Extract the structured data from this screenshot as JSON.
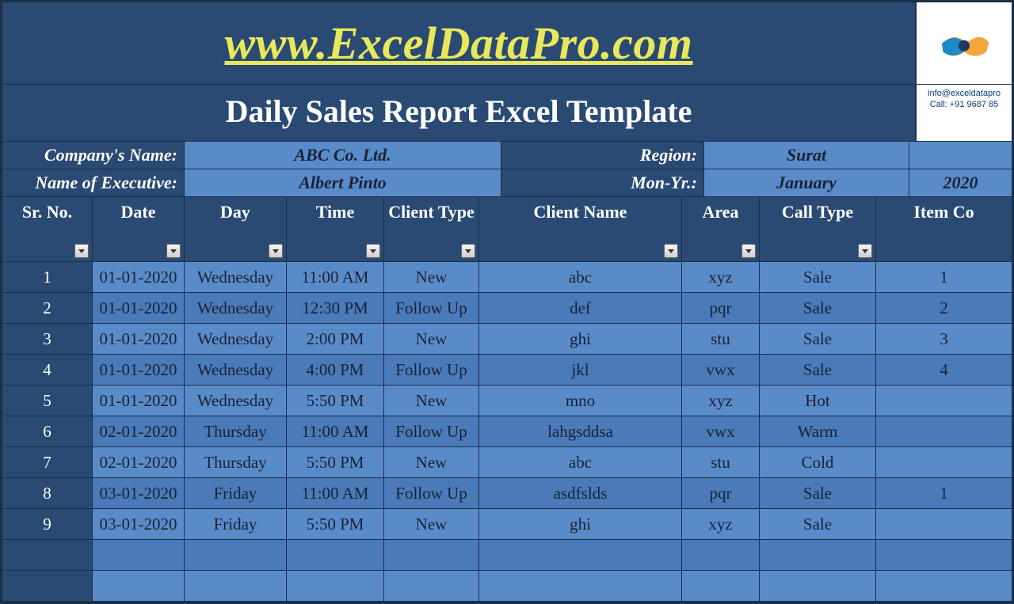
{
  "banner": {
    "url": "www.ExcelDataPro.com"
  },
  "logo": {
    "email": "info@exceldatapro",
    "phone": "Call: +91 9687 85"
  },
  "title": "Daily Sales Report Excel Template",
  "info": {
    "company_label": "Company's Name:",
    "company_value": "ABC Co. Ltd.",
    "region_label": "Region:",
    "region_value": "Surat",
    "exec_label": "Name of Executive:",
    "exec_value": "Albert Pinto",
    "monyr_label": "Mon-Yr.:",
    "month_value": "January",
    "year_value": "2020"
  },
  "headers": {
    "srno": "Sr. No.",
    "date": "Date",
    "day": "Day",
    "time": "Time",
    "ctype": "Client Type",
    "cname": "Client Name",
    "area": "Area",
    "call": "Call Type",
    "item": "Item Co"
  },
  "rows": [
    {
      "sr": "1",
      "date": "01-01-2020",
      "day": "Wednesday",
      "time": "11:00 AM",
      "ctype": "New",
      "cname": "abc",
      "area": "xyz",
      "call": "Sale",
      "item": "1"
    },
    {
      "sr": "2",
      "date": "01-01-2020",
      "day": "Wednesday",
      "time": "12:30 PM",
      "ctype": "Follow Up",
      "cname": "def",
      "area": "pqr",
      "call": "Sale",
      "item": "2"
    },
    {
      "sr": "3",
      "date": "01-01-2020",
      "day": "Wednesday",
      "time": "2:00 PM",
      "ctype": "New",
      "cname": "ghi",
      "area": "stu",
      "call": "Sale",
      "item": "3"
    },
    {
      "sr": "4",
      "date": "01-01-2020",
      "day": "Wednesday",
      "time": "4:00 PM",
      "ctype": "Follow Up",
      "cname": "jkl",
      "area": "vwx",
      "call": "Sale",
      "item": "4"
    },
    {
      "sr": "5",
      "date": "01-01-2020",
      "day": "Wednesday",
      "time": "5:50 PM",
      "ctype": "New",
      "cname": "mno",
      "area": "xyz",
      "call": "Hot",
      "item": ""
    },
    {
      "sr": "6",
      "date": "02-01-2020",
      "day": "Thursday",
      "time": "11:00 AM",
      "ctype": "Follow Up",
      "cname": "lahgsddsa",
      "area": "vwx",
      "call": "Warm",
      "item": ""
    },
    {
      "sr": "7",
      "date": "02-01-2020",
      "day": "Thursday",
      "time": "5:50 PM",
      "ctype": "New",
      "cname": "abc",
      "area": "stu",
      "call": "Cold",
      "item": ""
    },
    {
      "sr": "8",
      "date": "03-01-2020",
      "day": "Friday",
      "time": "11:00 AM",
      "ctype": "Follow Up",
      "cname": "asdfslds",
      "area": "pqr",
      "call": "Sale",
      "item": "1"
    },
    {
      "sr": "9",
      "date": "03-01-2020",
      "day": "Friday",
      "time": "5:50 PM",
      "ctype": "New",
      "cname": "ghi",
      "area": "xyz",
      "call": "Sale",
      "item": ""
    },
    {
      "sr": "",
      "date": "",
      "day": "",
      "time": "",
      "ctype": "",
      "cname": "",
      "area": "",
      "call": "",
      "item": ""
    },
    {
      "sr": "",
      "date": "",
      "day": "",
      "time": "",
      "ctype": "",
      "cname": "",
      "area": "",
      "call": "",
      "item": ""
    }
  ]
}
